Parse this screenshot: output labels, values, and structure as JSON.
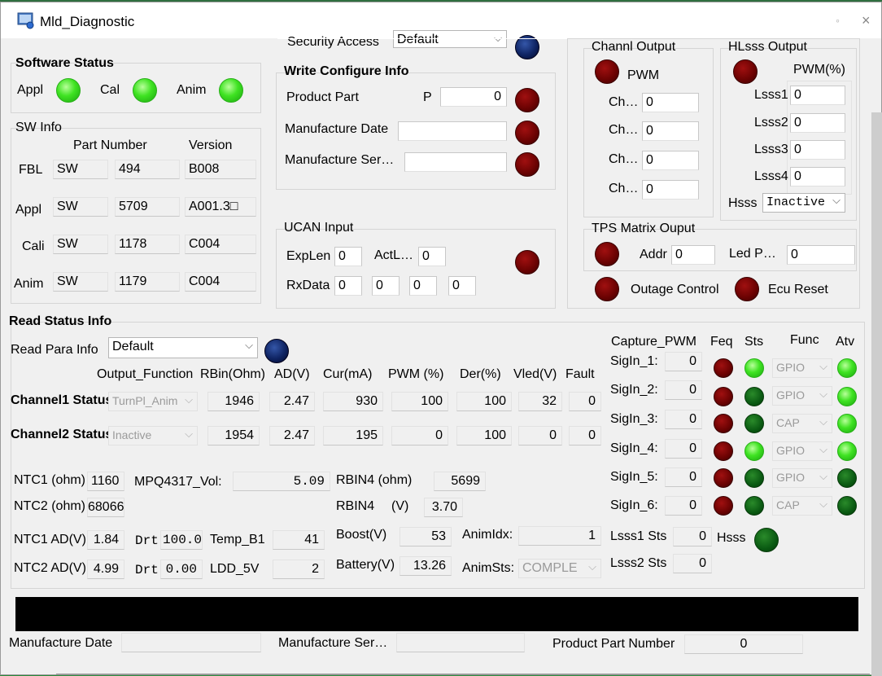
{
  "window": {
    "title": "Mld_Diagnostic",
    "close": "×",
    "sys": "◦"
  },
  "software_status": {
    "title": "Software Status",
    "items": [
      {
        "label": "Appl"
      },
      {
        "label": "Cal"
      },
      {
        "label": "Anim"
      }
    ]
  },
  "sw_info": {
    "title": "SW Info",
    "headers": [
      "Part Number",
      "Version"
    ],
    "rows": [
      {
        "label": "FBL",
        "prefix": "SW",
        "number": "494",
        "version": "B008"
      },
      {
        "label": "Appl",
        "prefix": "SW",
        "number": "5709",
        "version": "A001.3□"
      },
      {
        "label": "Cali",
        "prefix": "SW",
        "number": "1178",
        "version": "C004"
      },
      {
        "label": "Anim",
        "prefix": "SW",
        "number": "1179",
        "version": "C004"
      }
    ]
  },
  "security": {
    "label": "Security Access",
    "value": "Default"
  },
  "write_config": {
    "title": "Write Configure Info",
    "product_part": "Product Part",
    "p_label": "P",
    "p_value": "0",
    "manufacture_date": "Manufacture Date",
    "manufacture_ser": "Manufacture Ser…"
  },
  "ucan": {
    "title": "UCAN Input",
    "explen_label": "ExpLen",
    "explen": "0",
    "actl_label": "ActL…",
    "actl": "0",
    "rxdata_label": "RxData",
    "rxdata": [
      "0",
      "0",
      "0",
      "0"
    ]
  },
  "channl_output": {
    "title": "Channl Output",
    "pwm": "PWM",
    "rows": [
      {
        "label": "Ch…",
        "value": "0"
      },
      {
        "label": "Ch…",
        "value": "0"
      },
      {
        "label": "Ch…",
        "value": "0"
      },
      {
        "label": "Ch…",
        "value": "0"
      }
    ]
  },
  "hlsss_output": {
    "title": "HLsss Output",
    "pwm": "PWM(%)",
    "rows": [
      {
        "label": "Lsss1",
        "value": "0"
      },
      {
        "label": "Lsss2",
        "value": "0"
      },
      {
        "label": "Lsss3",
        "value": "0"
      },
      {
        "label": "Lsss4",
        "value": "0"
      }
    ],
    "hsss_label": "Hsss",
    "hsss_value": "Inactive"
  },
  "tps_matrix": {
    "title": "TPS Matrix Ouput",
    "addr_label": "Addr",
    "addr": "0",
    "led_label": "Led P…",
    "led": "0",
    "outage": "Outage Control",
    "ecu_reset": "Ecu Reset"
  },
  "read_status": {
    "title": "Read Status Info",
    "para_label": "Read Para Info",
    "para_value": "Default",
    "headers": [
      "Output_Function",
      "RBin(Ohm)",
      "AD(V)",
      "Cur(mA)",
      "PWM (%)",
      "Der(%)",
      "Vled(V)",
      "Fault"
    ],
    "channels": [
      {
        "label": "Channel1 Status",
        "func": "TurnPl_Anim",
        "rbin": "1946",
        "ad": "2.47",
        "cur": "930",
        "pwm": "100",
        "der": "100",
        "vled": "32",
        "fault": "0"
      },
      {
        "label": "Channel2 Status",
        "func": "Inactive",
        "rbin": "1954",
        "ad": "2.47",
        "cur": "195",
        "pwm": "0",
        "der": "100",
        "vled": "0",
        "fault": "0"
      }
    ],
    "ntc1_ohm_label": "NTC1 (ohm)",
    "ntc1_ohm": "1160",
    "ntc2_ohm_label": "NTC2 (ohm)",
    "ntc2_ohm": "68066",
    "ntc1_ad_label": "NTC1 AD(V)",
    "ntc1_ad": "1.84",
    "ntc2_ad_label": "NTC2 AD(V)",
    "ntc2_ad": "4.99",
    "drt_label": "Drt",
    "drt1": "100.00",
    "drt2": "0.00",
    "mpq_label": "MPQ4317_Vol:",
    "mpq": "5.09",
    "temp_label": "Temp_B1",
    "temp": "41",
    "ldd_label": "LDD_5V",
    "ldd": "2",
    "rbin4_ohm_label": "RBIN4 (ohm)",
    "rbin4_ohm": "5699",
    "rbin4_v_label": "RBIN4",
    "rbin4_v_unit": "(V)",
    "rbin4_v": "3.70",
    "boost_label": "Boost(V)",
    "boost": "53",
    "battery_label": "Battery(V)",
    "battery": "13.26",
    "animidx_label": "AnimIdx:",
    "animidx": "1",
    "animsts_label": "AnimSts:",
    "animsts": "COMPLE"
  },
  "capture": {
    "headers": [
      "Capture_PWM",
      "Feq",
      "Sts",
      "Func",
      "Atv"
    ],
    "rows": [
      {
        "label": "SigIn_1:",
        "value": "0",
        "func": "GPIO"
      },
      {
        "label": "SigIn_2:",
        "value": "0",
        "func": "GPIO"
      },
      {
        "label": "SigIn_3:",
        "value": "0",
        "func": "CAP"
      },
      {
        "label": "SigIn_4:",
        "value": "0",
        "func": "GPIO"
      },
      {
        "label": "SigIn_5:",
        "value": "0",
        "func": "GPIO"
      },
      {
        "label": "SigIn_6:",
        "value": "0",
        "func": "CAP"
      }
    ],
    "lsss1_label": "Lsss1 Sts",
    "lsss1": "0",
    "lsss2_label": "Lsss2 Sts",
    "lsss2": "0",
    "hsss_label": "Hsss"
  },
  "footer": {
    "manufacture_date": "Manufacture Date",
    "manufacture_ser": "Manufacture Ser…",
    "product_part_number": "Product Part Number",
    "product_part_value": "0"
  }
}
